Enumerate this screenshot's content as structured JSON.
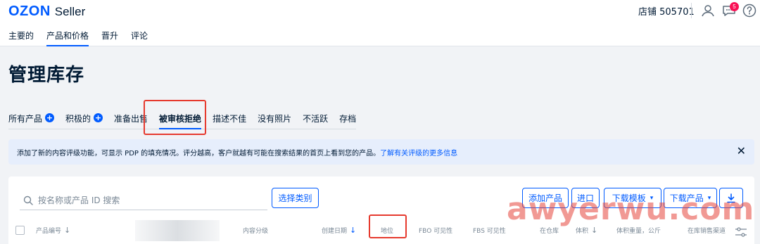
{
  "header": {
    "logo_brand": "OZON",
    "logo_product": "Seller",
    "store_label": "店铺 505701",
    "notification_count": "5"
  },
  "nav": {
    "items": [
      "主要的",
      "产品和价格",
      "晋升",
      "评论"
    ],
    "active_index": 1
  },
  "page": {
    "title": "管理库存"
  },
  "tabs": {
    "items": [
      {
        "label": "所有产品",
        "has_plus": true
      },
      {
        "label": "积极的",
        "has_plus": true
      },
      {
        "label": "准备出售",
        "has_plus": false
      },
      {
        "label": "被审核拒绝",
        "has_plus": false
      },
      {
        "label": "描述不佳",
        "has_plus": false
      },
      {
        "label": "没有照片",
        "has_plus": false
      },
      {
        "label": "不活跃",
        "has_plus": false
      },
      {
        "label": "存档",
        "has_plus": false
      }
    ],
    "active_index": 3
  },
  "banner": {
    "text": "添加了新的内容评级功能，可显示 PDP 的填充情况。评分越高，客户就越有可能在搜索结果的首页上看到您的产品。",
    "link": "了解有关评级的更多信息"
  },
  "toolbar": {
    "search_placeholder": "按名称或产品 ID 搜索",
    "choose_category": "选择类别",
    "add_product": "添加产品",
    "import": "进口",
    "download_template": "下载模板",
    "download_products": "下载产品"
  },
  "table": {
    "columns": [
      "产品编号",
      "内容分级",
      "创建日期",
      "地位",
      "FBO 可见性",
      "FBS 可见性",
      "在仓库",
      "体积",
      "体积重量，公斤",
      "在库销售渠道"
    ]
  },
  "watermark": "awyerwu.com",
  "colors": {
    "brand_blue": "#005bff",
    "highlight_red": "#e63a2e",
    "banner_bg": "#e6eefc",
    "badge_red": "#f91155"
  }
}
